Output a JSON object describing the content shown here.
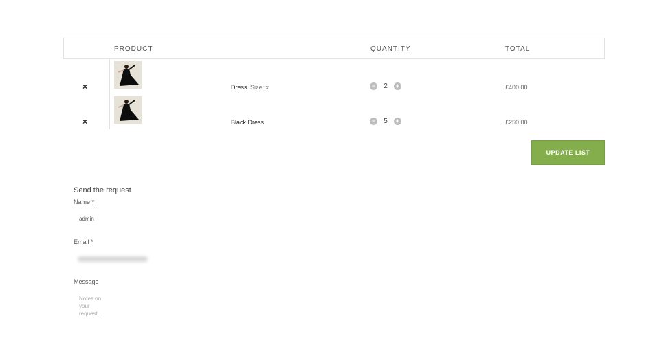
{
  "cart": {
    "headers": {
      "product": "PRODUCT",
      "quantity": "QUANTITY",
      "total": "TOTAL"
    },
    "remove_symbol": "×",
    "qty_minus": "−",
    "qty_plus": "+",
    "items": [
      {
        "name": "Dress",
        "variant": "Size: x",
        "quantity": "2",
        "total": "£400.00"
      },
      {
        "name": "Black Dress",
        "variant": "",
        "quantity": "5",
        "total": "£250.00"
      }
    ],
    "update_label": "UPDATE LIST"
  },
  "form": {
    "title": "Send the request",
    "name_label": "Name",
    "name_required": "*",
    "name_value": "admin",
    "email_label": "Email",
    "email_required": "*",
    "message_label": "Message",
    "message_placeholder": "Notes on your request..."
  },
  "colors": {
    "accent": "#84ad4c"
  }
}
